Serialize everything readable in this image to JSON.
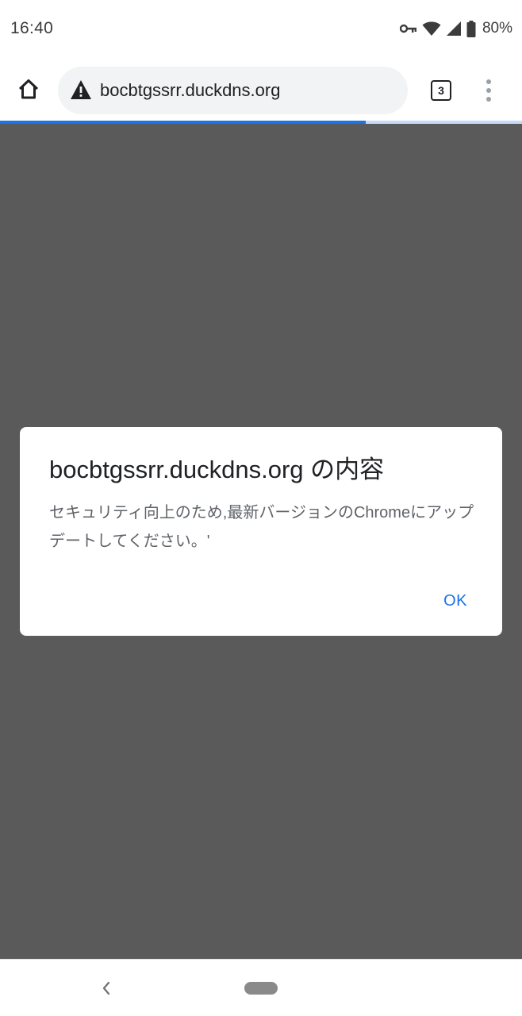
{
  "status_bar": {
    "time": "16:40",
    "battery_percent": "80%",
    "icons": [
      "vpn-key-icon",
      "wifi-icon",
      "cell-signal-icon",
      "battery-icon"
    ]
  },
  "toolbar": {
    "url": "bocbtgssrr.duckdns.org",
    "security_icon": "warning-triangle-icon",
    "tab_count": "3",
    "home_icon": "home-icon",
    "menu_icon": "more-vert-icon"
  },
  "progress": {
    "fraction": 0.7,
    "color": "#1a73e8"
  },
  "dialog": {
    "title": "bocbtgssrr.duckdns.org の内容",
    "message": "セキュリティ向上のため,最新バージョンのChromeにアップデートしてください。'",
    "ok_label": "OK"
  },
  "nav_bar": {
    "back_icon": "back-chevron-icon",
    "home_icon": "home-pill-icon"
  },
  "colors": {
    "accent": "#1a73e8",
    "scrim": "#5a5a5a"
  }
}
